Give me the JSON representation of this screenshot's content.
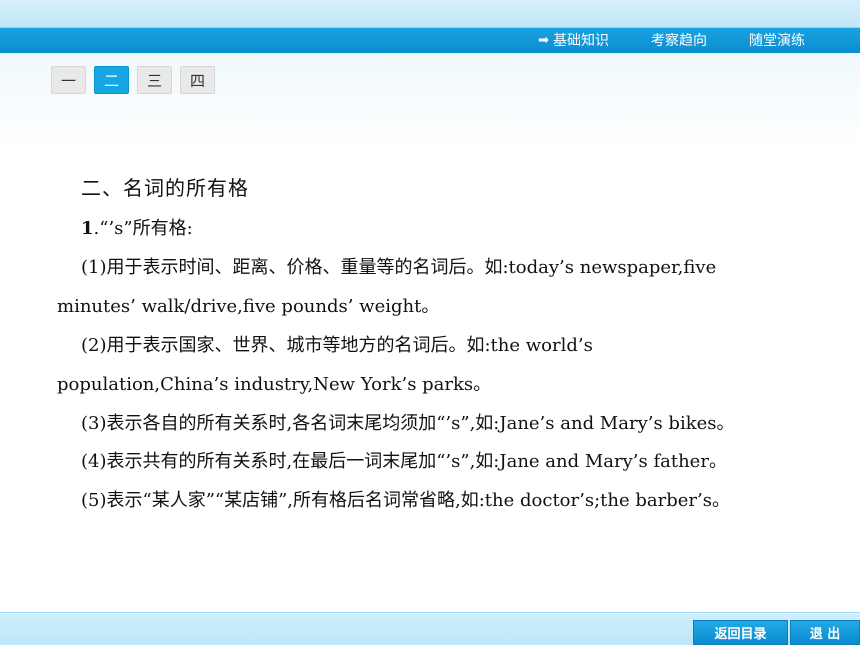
{
  "nav": {
    "items": [
      {
        "label": "基础知识",
        "icon": "arrow-right-icon"
      },
      {
        "label": "考察趋向"
      },
      {
        "label": "随堂演练"
      }
    ]
  },
  "tabs": [
    {
      "label": "一",
      "active": false
    },
    {
      "label": "二",
      "active": true
    },
    {
      "label": "三",
      "active": false
    },
    {
      "label": "四",
      "active": false
    }
  ],
  "content": {
    "heading": "二、名词的所有格",
    "item1_num": "1",
    "item1_text": ".“’s”所有格:",
    "lines": [
      "(1)用于表示时间、距离、价格、重量等的名词后。如:today’s newspaper,five",
      "minutes’ walk/drive,five pounds’ weight。",
      "(2)用于表示国家、世界、城市等地方的名词后。如:the world’s",
      "population,China’s industry,New York’s parks。",
      "(3)表示各自的所有关系时,各名词末尾均须加“’s”,如:Jane’s and Mary’s bikes。",
      "(4)表示共有的所有关系时,在最后一词末尾加“’s”,如:Jane and Mary’s father。",
      "(5)表示“某人家”“某店铺”,所有格后名词常省略,如:the doctor’s;the barber’s。"
    ]
  },
  "footer": {
    "back_label": "返回目录",
    "exit_label": "退 出"
  },
  "colors": {
    "accent": "#16a6e4",
    "bar": "#0b8dd0"
  }
}
